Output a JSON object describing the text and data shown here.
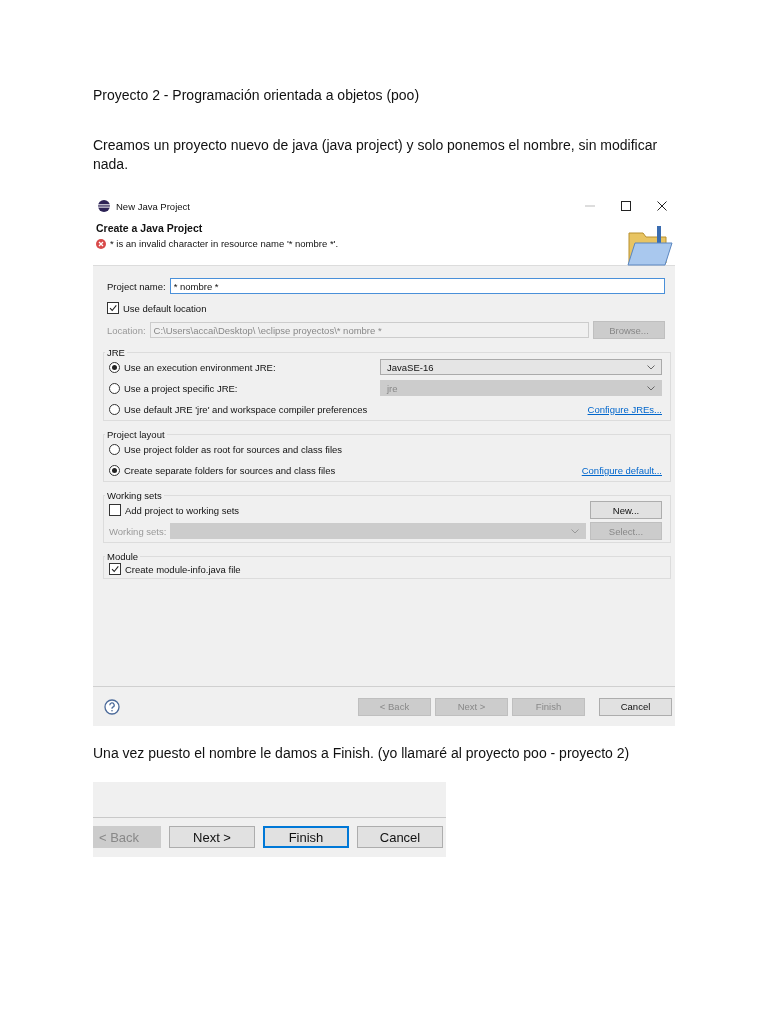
{
  "heading": "Proyecto 2 - Programación orientada a objetos (poo)",
  "intro": "Creamos un proyecto nuevo de java (java project) y solo ponemos el nombre, sin modificar nada.",
  "dialog": {
    "title": "New Java Project",
    "header": "Create a Java Project",
    "error": "* is an invalid character in resource name '* nombre *'.",
    "project_name": {
      "label": "Project name:",
      "value": "* nombre *"
    },
    "default_location": {
      "label": "Use default location",
      "checked": true
    },
    "location": {
      "label": "Location:",
      "value": "C:\\Users\\accai\\Desktop\\ \\eclipse proyectos\\* nombre *",
      "disabled": true,
      "button": "Browse...",
      "button_disabled": true
    },
    "jre": {
      "title": "JRE",
      "options": [
        {
          "label": "Use an execution environment JRE:",
          "selected": true,
          "combo": "JavaSE-16",
          "combo_disabled": false
        },
        {
          "label": "Use a project specific JRE:",
          "selected": false,
          "combo": "jre",
          "combo_disabled": true
        },
        {
          "label": "Use default JRE 'jre' and workspace compiler preferences",
          "selected": false,
          "link": "Configure JREs..."
        }
      ]
    },
    "layout": {
      "title": "Project layout",
      "options": [
        {
          "label": "Use project folder as root for sources and class files",
          "selected": false
        },
        {
          "label": "Create separate folders for sources and class files",
          "selected": true,
          "link": "Configure default..."
        }
      ]
    },
    "working_sets": {
      "title": "Working sets",
      "add": {
        "label": "Add project to working sets",
        "checked": false
      },
      "new_button": "New...",
      "sets_label": "Working sets:",
      "sets_disabled": true,
      "select_button": "Select...",
      "select_disabled": true
    },
    "module": {
      "title": "Module",
      "create": {
        "label": "Create module-info.java file",
        "checked": true
      }
    },
    "buttons": [
      {
        "label": "< Back",
        "disabled": true,
        "selected": false
      },
      {
        "label": "Next >",
        "disabled": true,
        "selected": false
      },
      {
        "label": "Finish",
        "disabled": true,
        "selected": false
      },
      {
        "label": "Cancel",
        "disabled": false,
        "selected": false
      }
    ]
  },
  "caption": "Una vez puesto el nombre le damos a Finish. (yo llamaré al proyecto poo - proyecto 2)",
  "finish_screenshot": {
    "buttons": [
      {
        "label": "< Back",
        "disabled": true,
        "selected": false
      },
      {
        "label": "Next >",
        "disabled": false,
        "selected": false
      },
      {
        "label": "Finish",
        "disabled": false,
        "selected": true
      },
      {
        "label": "Cancel",
        "disabled": false,
        "selected": false
      }
    ]
  }
}
